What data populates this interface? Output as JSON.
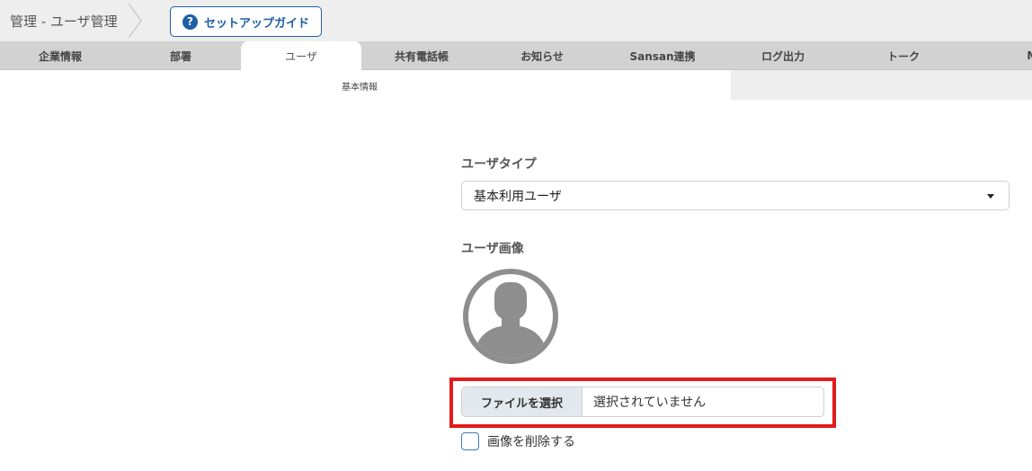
{
  "header": {
    "breadcrumb": "管理 - ユーザ管理",
    "guide_button": "セットアップガイド",
    "guide_icon_glyph": "?"
  },
  "tabs": [
    {
      "label": "企業情報",
      "active": false
    },
    {
      "label": "部署",
      "active": false
    },
    {
      "label": "ユーザ",
      "active": true
    },
    {
      "label": "共有電話帳",
      "active": false
    },
    {
      "label": "お知らせ",
      "active": false
    },
    {
      "label": "Sansan連携",
      "active": false
    },
    {
      "label": "ログ出力",
      "active": false
    },
    {
      "label": "トーク",
      "active": false
    },
    {
      "label": "Microsoft",
      "active": false
    }
  ],
  "subtabs": [
    {
      "label": "基本情報",
      "active": true
    }
  ],
  "form": {
    "user_type_label": "ユーザタイプ",
    "user_type_value": "基本利用ユーザ",
    "user_image_label": "ユーザ画像",
    "file_button_label": "ファイルを選択",
    "file_status": "選択されていません",
    "delete_image_label": "画像を削除する",
    "delete_image_checked": false
  },
  "colors": {
    "accent": "#1f5fa6",
    "highlight": "#e21b1b",
    "tab_bar": "#d2d2d2",
    "avatar": "#8e8e8e"
  }
}
